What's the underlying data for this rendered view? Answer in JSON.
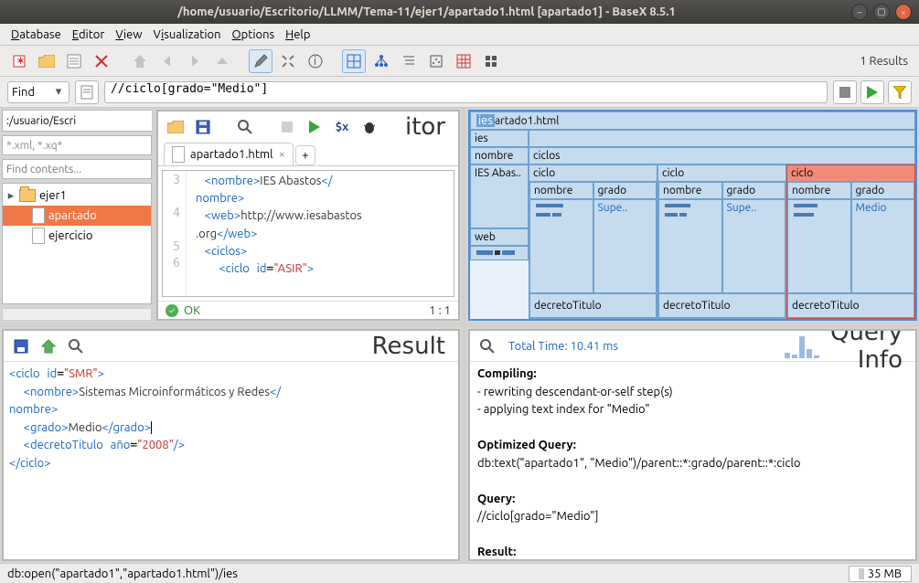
{
  "window": {
    "title": "/home/usuario/Escritorio/LLMM/Tema-11/ejer1/apartado1.html [apartado1] - BaseX 8.5.1"
  },
  "menu": {
    "database": "Database",
    "editor": "Editor",
    "view": "View",
    "visualization": "Visualization",
    "options": "Options",
    "help": "Help"
  },
  "toolbar": {
    "results": "1 Results"
  },
  "search": {
    "mode": "Find",
    "query": "//ciclo[grado=\"Medio\"]"
  },
  "nav": {
    "path": ":/usuario/Escri",
    "pathbtn": "...",
    "filter": "*.xml, *.xq*",
    "find": "Find contents...",
    "tree": [
      {
        "type": "folder",
        "name": "ejer1",
        "expand": true,
        "indent": 1,
        "arrow": "▸"
      },
      {
        "type": "file",
        "name": "apartado",
        "indent": 2,
        "sel": true,
        "display": "apartado"
      },
      {
        "type": "file",
        "name": "ejercicio",
        "indent": 2
      }
    ]
  },
  "editor": {
    "title": "itor",
    "tab": "apartado1.html",
    "tabclose": "×",
    "plus": "+",
    "lines": [
      3,
      4,
      5,
      6
    ],
    "code_html": "  <span class='tag'>&lt;nombre&gt;</span><span class='txt'>IES Abastos</span><span class='tag'>&lt;/\n  nombre&gt;</span>\n  <span class='tag'>&lt;web&gt;</span><span class='txt'>http://www.iesabastos\n  .org</span><span class='tag'>&lt;/web&gt;</span>\n  <span class='tag'>&lt;ciclos&gt;</span>\n    <span class='tag'>&lt;ciclo</span> <span class='attr'>id</span>=<span class='val'>\"ASIR\"</span><span class='tag'>&gt;</span>",
    "status": "OK",
    "pos": "1 : 1"
  },
  "viz": {
    "root": "iesartado1.html",
    "ies": "ies",
    "nombre": "nombre",
    "ciclos": "ciclos",
    "iesval": "IES Abas..",
    "web": "web",
    "ciclo": "ciclo",
    "nombrecol": "nombre",
    "gradocol": "grado",
    "supe": "Supe..",
    "medio": "Medio",
    "decreto": "decretoTitulo"
  },
  "result": {
    "title": "Result",
    "code_html": "<span class='tag'>&lt;ciclo</span> <span class='attr'>id</span>=<span class='val'>\"SMR\"</span><span class='tag'>&gt;</span>\n  <span class='tag'>&lt;nombre&gt;</span><span class='txt'>Sistemas Microinformáticos y Redes</span><span class='tag'>&lt;/\nnombre&gt;</span>\n  <span class='tag'>&lt;grado&gt;</span><span class='txt'>Medio</span><span class='tag'>&lt;/grado&gt;</span><span class='cursor'></span>\n  <span class='tag'>&lt;decretoTitulo</span> <span class='attr'>año</span>=<span class='val'>\"2008\"</span><span class='tag'>/&gt;</span>\n<span class='tag'>&lt;/ciclo&gt;</span>"
  },
  "queryinfo": {
    "title": "Query Info",
    "time": "Total Time: 10.41 ms",
    "compiling": "Compiling:",
    "c1": "- rewriting descendant-or-self step(s)",
    "c2": "- applying text index for \"Medio\"",
    "opt": "Optimized Query:",
    "optq": "db:text(\"apartado1\", \"Medio\")/parent::*:grado/parent::*:ciclo",
    "q": "Query:",
    "qq": "//ciclo[grado=\"Medio\"]",
    "res": "Result:"
  },
  "status": {
    "text": "db:open(\"apartado1\",\"apartado1.html\")/ies",
    "mem": "35 MB"
  }
}
